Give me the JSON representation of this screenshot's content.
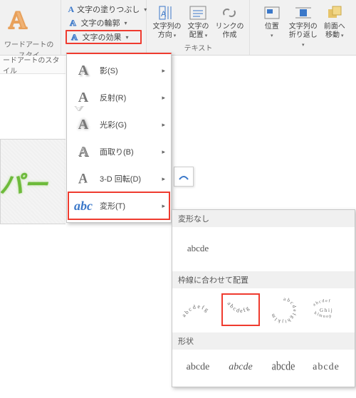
{
  "ribbon": {
    "wordart": {
      "big_glyph": "A",
      "fill_label": "文字の塗りつぶし",
      "outline_label": "文字の輪郭",
      "effects_label": "文字の効果",
      "group_label": "ワードアートのスタイ"
    },
    "text": {
      "direction_l1": "文字列の",
      "direction_l2": "方向",
      "align_l1": "文字の",
      "align_l2": "配置",
      "link_l1": "リンクの",
      "link_l2": "作成",
      "group_label": "テキスト"
    },
    "arrange": {
      "position_l1": "位置",
      "position_l2": "",
      "wrap_l1": "文字列の",
      "wrap_l2": "折り返し",
      "back_l1": "前面へ",
      "back_l2": "移動",
      "group_label": ""
    }
  },
  "sidebar": {
    "tab": "ードアートのスタイル"
  },
  "wa_sample": "パー",
  "fx_menu": {
    "items": [
      {
        "label": "影(S)"
      },
      {
        "label": "反射(R)"
      },
      {
        "label": "光彩(G)"
      },
      {
        "label": "面取り(B)"
      },
      {
        "label": "3-D 回転(D)"
      },
      {
        "label": "変形(T)"
      }
    ]
  },
  "sub": {
    "none_hdr": "変形なし",
    "none_sample": "abcde",
    "follow_hdr": "枠線に合わせて配置",
    "shape_hdr": "形状",
    "sample": "abcde"
  }
}
